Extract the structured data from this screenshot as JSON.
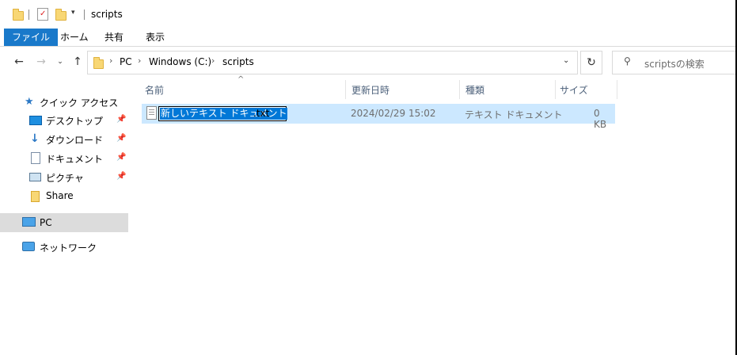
{
  "window": {
    "title": "scripts"
  },
  "ribbon": {
    "tabs": [
      "ファイル",
      "ホーム",
      "共有",
      "表示"
    ]
  },
  "address": {
    "crumbs": [
      "PC",
      "Windows (C:)",
      "scripts"
    ]
  },
  "search": {
    "placeholder": "scriptsの検索"
  },
  "nav": {
    "quick_access": "クイック アクセス",
    "items": [
      {
        "label": "デスクトップ",
        "icon": "desktop-icon",
        "pinned": true
      },
      {
        "label": "ダウンロード",
        "icon": "download-icon",
        "pinned": true
      },
      {
        "label": "ドキュメント",
        "icon": "document-icon",
        "pinned": true
      },
      {
        "label": "ピクチャ",
        "icon": "pictures-icon",
        "pinned": true
      },
      {
        "label": "Share",
        "icon": "folder-icon",
        "pinned": false
      }
    ],
    "pc": "PC",
    "network": "ネットワーク"
  },
  "columns": {
    "name": "名前",
    "date": "更新日時",
    "type": "種類",
    "size": "サイズ"
  },
  "files": [
    {
      "name_selected": "新しいテキスト ドキュメント",
      "name_ext": ".txt",
      "date": "2024/02/29 15:02",
      "type": "テキスト ドキュメント",
      "size": "0 KB"
    }
  ],
  "colors": {
    "accent": "#1979ca",
    "selection": "#cce8ff",
    "highlight": "#0078d7"
  }
}
